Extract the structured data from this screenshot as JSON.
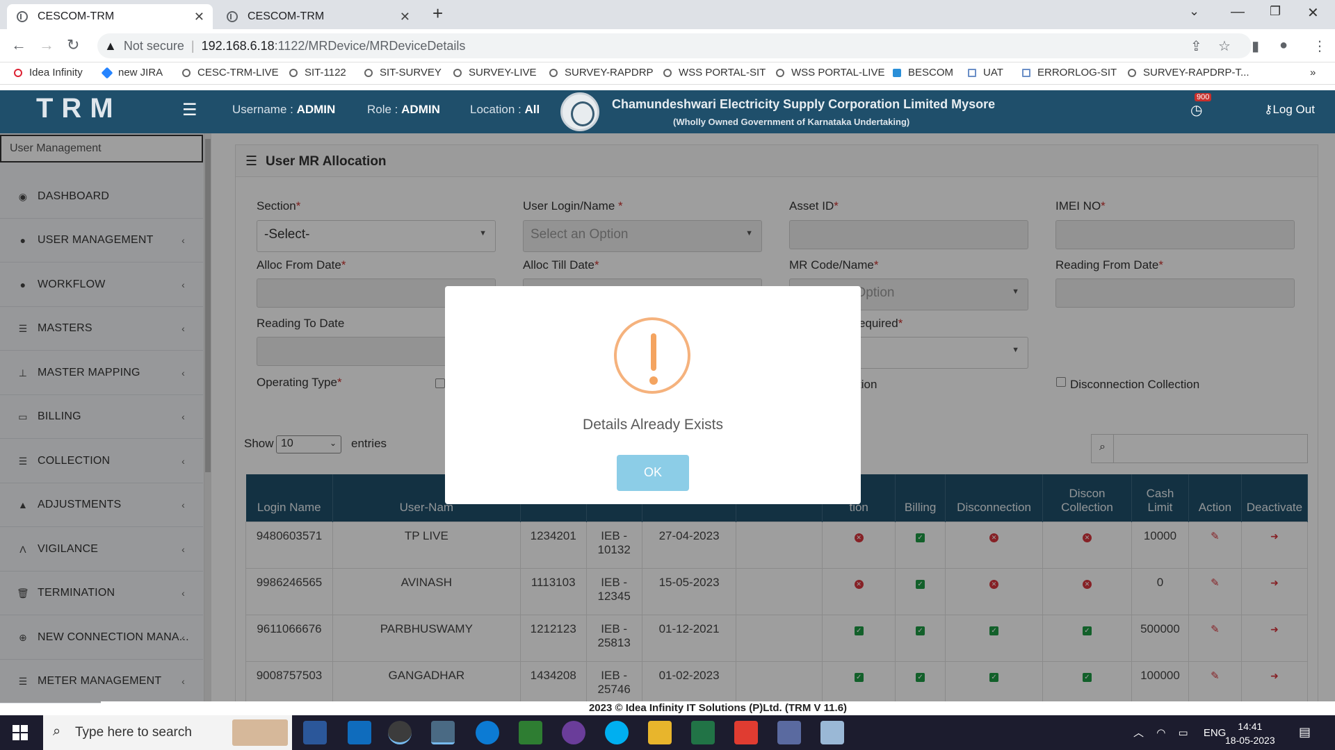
{
  "browser": {
    "tabs": [
      {
        "title": "CESCOM-TRM"
      },
      {
        "title": "CESCOM-TRM"
      }
    ],
    "not_secure": "Not secure",
    "url_host": "192.168.6.18",
    "url_path": ":1122/MRDevice/MRDeviceDetails",
    "bookmarks": [
      "Idea Infinity",
      "new JIRA",
      "CESC-TRM-LIVE",
      "SIT-1122",
      "SIT-SURVEY",
      "SURVEY-LIVE",
      "SURVEY-RAPDRP",
      "WSS PORTAL-SIT",
      "WSS PORTAL-LIVE",
      "BESCOM",
      "UAT",
      "ERRORLOG-SIT",
      "SURVEY-RAPDRP-T..."
    ]
  },
  "header": {
    "logo": "TRM",
    "username_label": "Username : ",
    "username": "ADMIN",
    "role_label": "Role : ",
    "role": "ADMIN",
    "location_label": "Location : ",
    "location": "All",
    "corp_name": "Chamundeshwari Electricity Supply Corporation Limited Mysore",
    "corp_sub": "(Wholly Owned Government of Karnataka Undertaking)",
    "notification_count": "900",
    "logout": "Log Out"
  },
  "sidebar": {
    "search_value": "User Management",
    "items": [
      {
        "label": "DASHBOARD",
        "icon": "dashboard-icon"
      },
      {
        "label": "USER MANAGEMENT",
        "icon": "user-icon"
      },
      {
        "label": "WORKFLOW",
        "icon": "user-icon"
      },
      {
        "label": "MASTERS",
        "icon": "list-icon"
      },
      {
        "label": "MASTER MAPPING",
        "icon": "sitemap-icon"
      },
      {
        "label": "BILLING",
        "icon": "monitor-icon"
      },
      {
        "label": "COLLECTION",
        "icon": "list-icon"
      },
      {
        "label": "ADJUSTMENTS",
        "icon": "adjust-icon"
      },
      {
        "label": "VIGILANCE",
        "icon": "vk-icon"
      },
      {
        "label": "TERMINATION",
        "icon": "trash-icon"
      },
      {
        "label": "NEW CONNECTION MANA...",
        "icon": "plus-circle-icon"
      },
      {
        "label": "METER MANAGEMENT",
        "icon": "list-icon"
      }
    ]
  },
  "page": {
    "title": "User MR Allocation",
    "fields": {
      "section_label": "Section",
      "section_value": "-Select-",
      "user_login_label": "User Login/Name ",
      "user_login_placeholder": "Select an Option",
      "asset_id_label": "Asset ID",
      "imei_label": "IMEI NO",
      "alloc_from_label": "Alloc From Date",
      "alloc_till_label": "Alloc Till Date",
      "mr_code_label": "MR Code/Name",
      "mr_code_placeholder": "Select an Option",
      "reading_from_label": "Reading From Date",
      "reading_to_label": "Reading To Date",
      "required_label_partial": "equired",
      "operating_type_label": "Operating Type",
      "partial_option_text": "tion",
      "disconnection_collection_label": "Disconnection Collection",
      "req_mark": "*"
    },
    "table_controls": {
      "show": "Show",
      "entries_value": "10",
      "entries": "entries"
    },
    "table": {
      "headers": [
        "Login Name",
        "User-Nam",
        "",
        "",
        "",
        "",
        "tion",
        "Billing",
        "Disconnection",
        "Discon Collection",
        "Cash Limit",
        "Action",
        "Deactivate"
      ],
      "rows": [
        {
          "login": "9480603571",
          "user": "TP LIVE",
          "code": "1234201",
          "ieb": "IEB - 10132",
          "date": "27-04-2023",
          "c1": "x",
          "billing": "ok",
          "disc": "x",
          "dcoll": "x",
          "cash": "10000"
        },
        {
          "login": "9986246565",
          "user": "AVINASH",
          "code": "1113103",
          "ieb": "IEB - 12345",
          "date": "15-05-2023",
          "c1": "x",
          "billing": "ok",
          "disc": "x",
          "dcoll": "x",
          "cash": "0"
        },
        {
          "login": "9611066676",
          "user": "PARBHUSWAMY",
          "code": "1212123",
          "ieb": "IEB - 25813",
          "date": "01-12-2021",
          "c1": "ok",
          "billing": "ok",
          "disc": "ok",
          "dcoll": "ok",
          "cash": "500000"
        },
        {
          "login": "9008757503",
          "user": "GANGADHAR",
          "code": "1434208",
          "ieb": "IEB - 25746",
          "date": "01-02-2023",
          "c1": "ok",
          "billing": "ok",
          "disc": "ok",
          "dcoll": "ok",
          "cash": "100000"
        }
      ]
    }
  },
  "modal": {
    "message": "Details Already Exists",
    "ok": "OK",
    "icon": "warning-icon"
  },
  "footer": "2023 © Idea Infinity IT Solutions (P)Ltd. (TRM V 11.6)",
  "taskbar": {
    "search_placeholder": "Type here to search",
    "language": "ENG",
    "time": "14:41",
    "date": "18-05-2023"
  },
  "colors": {
    "header_bg": "#1f4f6b",
    "warning": "#f4a460",
    "ok_button": "#8ccde7"
  }
}
